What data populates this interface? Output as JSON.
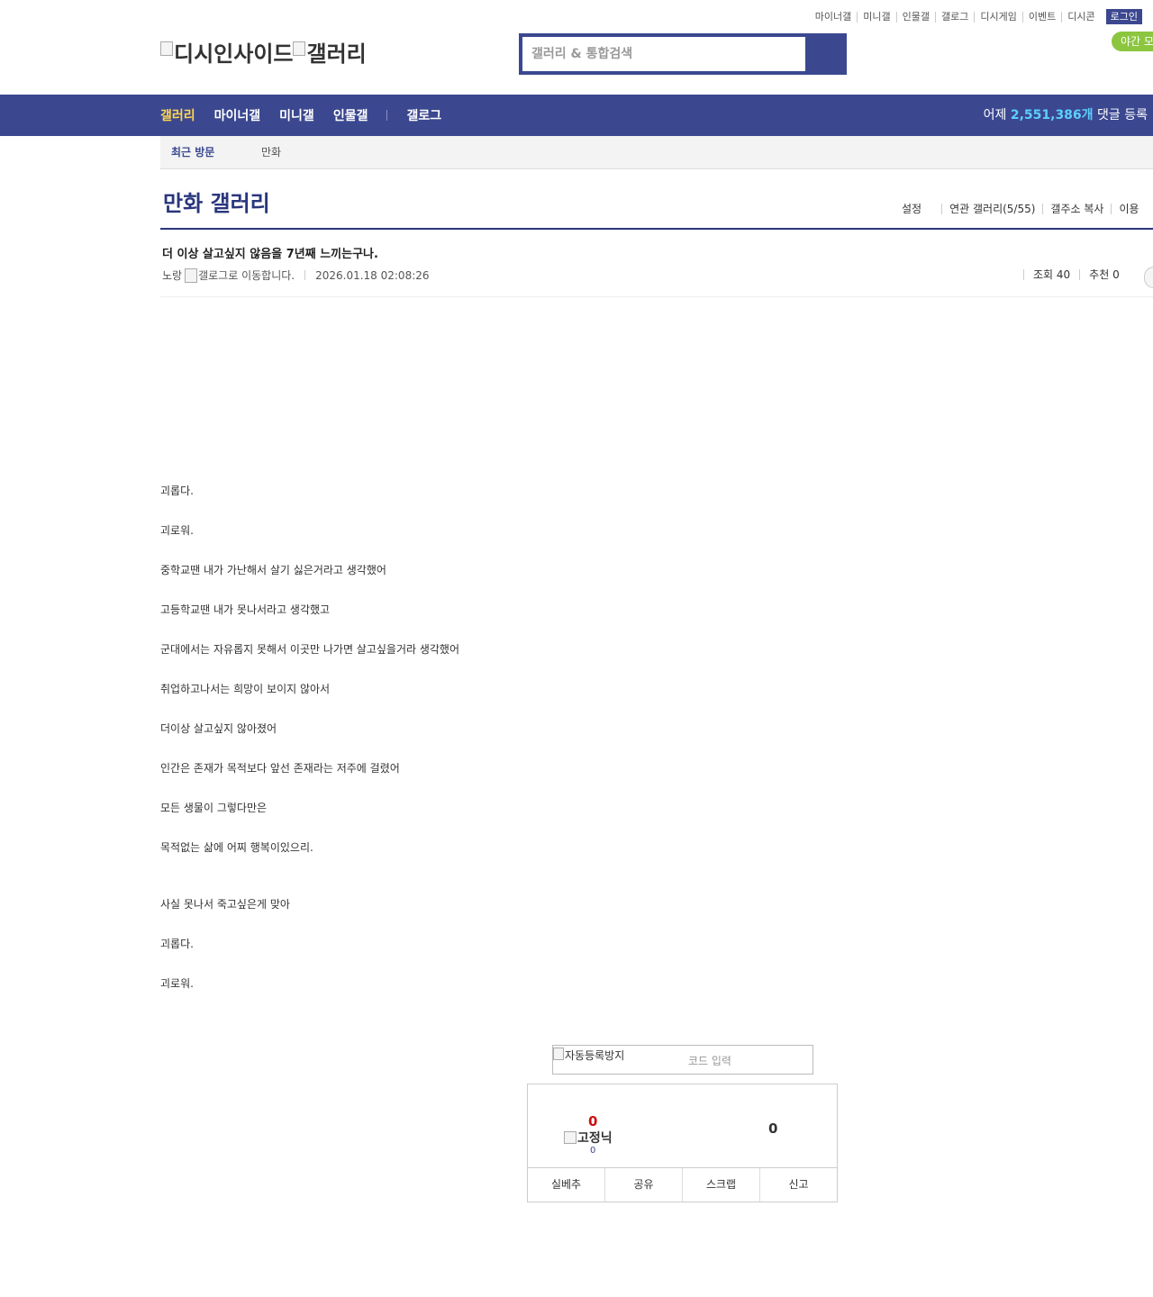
{
  "toplinks": [
    "마이너갤",
    "미니갤",
    "인물갤",
    "갤로그",
    "디시게임",
    "이벤트",
    "디시콘"
  ],
  "login_label": "로그인",
  "night_label": "야간 모",
  "logo": {
    "left_alt": "디시인사이드",
    "right_alt": "갤러리"
  },
  "search": {
    "placeholder": "갤러리 & 통합검색"
  },
  "nav": {
    "items": [
      "갤러리",
      "마이너갤",
      "미니갤",
      "인물갤",
      "갤로그"
    ],
    "stat_prefix": "어제",
    "stat_number": "2,551,386개",
    "stat_suffix": "댓글 등록"
  },
  "recent": {
    "label": "최근 방문",
    "item": "만화"
  },
  "gallery": {
    "title": "만화 갤러리",
    "options": [
      "설정",
      "연관 갤러리(5/55)",
      "갤주소 복사",
      "이용"
    ]
  },
  "post": {
    "title": "더 이상 살고싶지 않음을 7년째 느끼는구나.",
    "author": "노랑",
    "gallog_alt": "갤로그로 이동합니다.",
    "date": "2026.01.18 02:08:26",
    "views": "조회 40",
    "recommends": "추천 0",
    "body": [
      "괴롭다.",
      "괴로워.",
      "중학교땐 내가 가난해서 살기 싫은거라고 생각했어",
      "고등학교땐 내가 못나서라고 생각했고",
      "군대에서는 자유롭지 못해서 이곳만 나가면 살고싶을거라 생각했어",
      "취업하고나서는 희망이 보이지 않아서",
      "더이상 살고싶지 않아졌어",
      "인간은 존재가 목적보다 앞선 존재라는 저주에 걸렸어",
      "모든 생물이 그렇다만은",
      "목적없는 삶에 어찌 행복이있으리.",
      "사실 못나서 죽고싶은게 맞아",
      "괴롭다.",
      "괴로워."
    ]
  },
  "captcha": {
    "img_alt": "자동등록방지",
    "placeholder": "코드 입력"
  },
  "vote": {
    "up_count": "0",
    "fixed_label": "고정닉",
    "fixed_count": "0",
    "down_count": "0",
    "buttons": [
      "실베추",
      "공유",
      "스크랩",
      "신고"
    ]
  }
}
